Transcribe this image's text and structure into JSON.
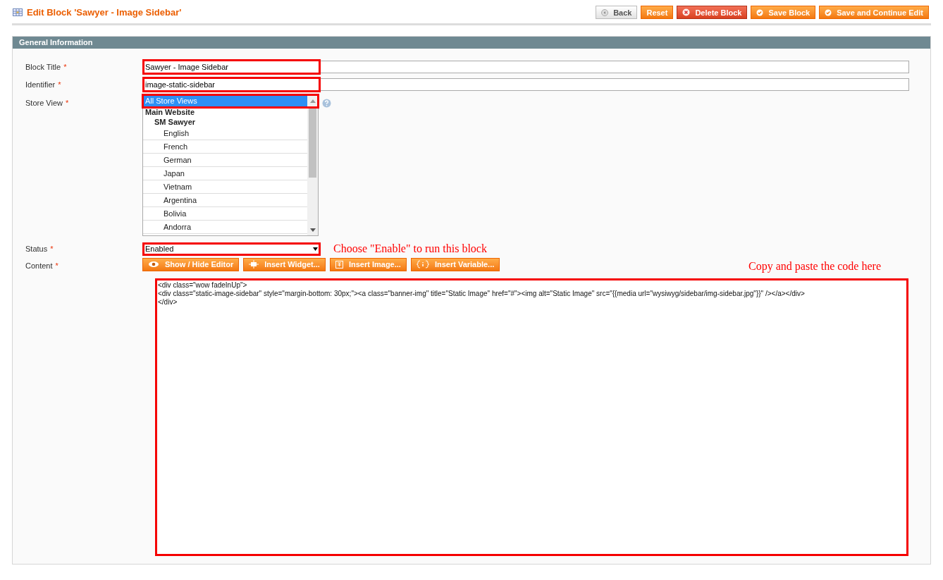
{
  "page_title": "Edit Block 'Sawyer - Image Sidebar'",
  "actions": [
    {
      "label": "Back",
      "kind": "back"
    },
    {
      "label": "Reset",
      "kind": "plain"
    },
    {
      "label": "Delete Block",
      "kind": "delete"
    },
    {
      "label": "Save Block",
      "kind": "save"
    },
    {
      "label": "Save and Continue Edit",
      "kind": "save"
    }
  ],
  "section": {
    "title": "General Information",
    "block_title": {
      "label": "Block Title",
      "required": "*",
      "value": "Sawyer - Image Sidebar",
      "highlighted": true
    },
    "identifier": {
      "label": "Identifier",
      "required": "*",
      "value": "image-static-sidebar",
      "highlighted": true
    },
    "store_view": {
      "label": "Store View",
      "required": "*",
      "highlighted": true,
      "options": [
        {
          "label": "All Store Views",
          "kind": "option",
          "selected": true
        },
        {
          "label": "Main Website",
          "kind": "group",
          "children": [
            {
              "label": "SM Sawyer",
              "kind": "group",
              "children": [
                {
                  "label": "English",
                  "kind": "option",
                  "selected": false
                },
                {
                  "label": "French",
                  "kind": "option",
                  "selected": false
                },
                {
                  "label": "German",
                  "kind": "option",
                  "selected": false
                },
                {
                  "label": "Japan",
                  "kind": "option",
                  "selected": false
                },
                {
                  "label": "Vietnam",
                  "kind": "option",
                  "selected": false
                },
                {
                  "label": "Argentina",
                  "kind": "option",
                  "selected": false
                },
                {
                  "label": "Bolivia",
                  "kind": "option",
                  "selected": false
                },
                {
                  "label": "Andorra",
                  "kind": "option",
                  "selected": false
                }
              ]
            }
          ]
        }
      ]
    },
    "status": {
      "label": "Status",
      "required": "*",
      "value": "Enabled",
      "highlighted": true,
      "note": "Choose \"Enable\" to run this block"
    },
    "content": {
      "label": "Content",
      "required": "*",
      "note": "Copy and paste the code here",
      "highlighted": true,
      "buttons": [
        {
          "label": "Show / Hide Editor",
          "kind": "eye"
        },
        {
          "label": "Insert Widget...",
          "kind": "widget"
        },
        {
          "label": "Insert Image...",
          "kind": "image"
        },
        {
          "label": "Insert Variable...",
          "kind": "variable"
        }
      ],
      "lines": [
        "<div class=\"wow fadeInUp\">",
        "<div class=\"static-image-sidebar\" style=\"margin-bottom: 30px;\"><a class=\"banner-img\" title=\"Static Image\" href=\"#\"><img alt=\"Static Image\" src=\"{{media url=\"wysiwyg/sidebar/img-sidebar.jpg\"}}\" /></a></div>",
        "</div>"
      ]
    }
  }
}
